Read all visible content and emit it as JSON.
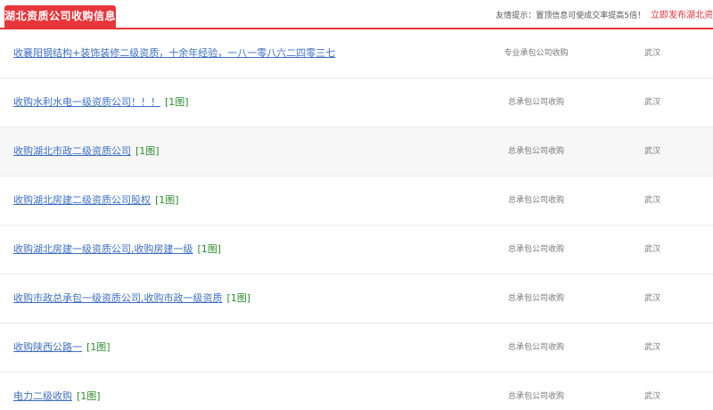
{
  "header": {
    "title": "湖北资质公司收购信息",
    "tip_text": "友情提示：置顶信息可使成交率提高5倍！",
    "tip_link": "立即发布湖北资"
  },
  "listings": [
    {
      "title": "收襄阳钢结构+装饰装修二级资质，十余年经验，一八一零八六二四零三七",
      "pic": "",
      "type": "专业承包公司收购",
      "city": "武汉"
    },
    {
      "title": "收购水利水电一级资质公司！！！",
      "pic": "[1图]",
      "type": "总承包公司收购",
      "city": "武汉"
    },
    {
      "title": "收购湖北市政二级资质公司",
      "pic": "[1图]",
      "type": "总承包公司收购",
      "city": "武汉"
    },
    {
      "title": "收购湖北房建二级资质公司股权",
      "pic": "[1图]",
      "type": "总承包公司收购",
      "city": "武汉"
    },
    {
      "title": "收购湖北房建一级资质公司,收购房建一级",
      "pic": "[1图]",
      "type": "总承包公司收购",
      "city": "武汉"
    },
    {
      "title": "收购市政总承包一级资质公司,收购市政一级资质",
      "pic": "[1图]",
      "type": "总承包公司收购",
      "city": "武汉"
    },
    {
      "title": "收购陕西公路一",
      "pic": "[1图]",
      "type": "总承包公司收购",
      "city": "武汉"
    },
    {
      "title": "电力二级收购",
      "pic": "[1图]",
      "type": "总承包公司收购",
      "city": "武汉"
    }
  ]
}
